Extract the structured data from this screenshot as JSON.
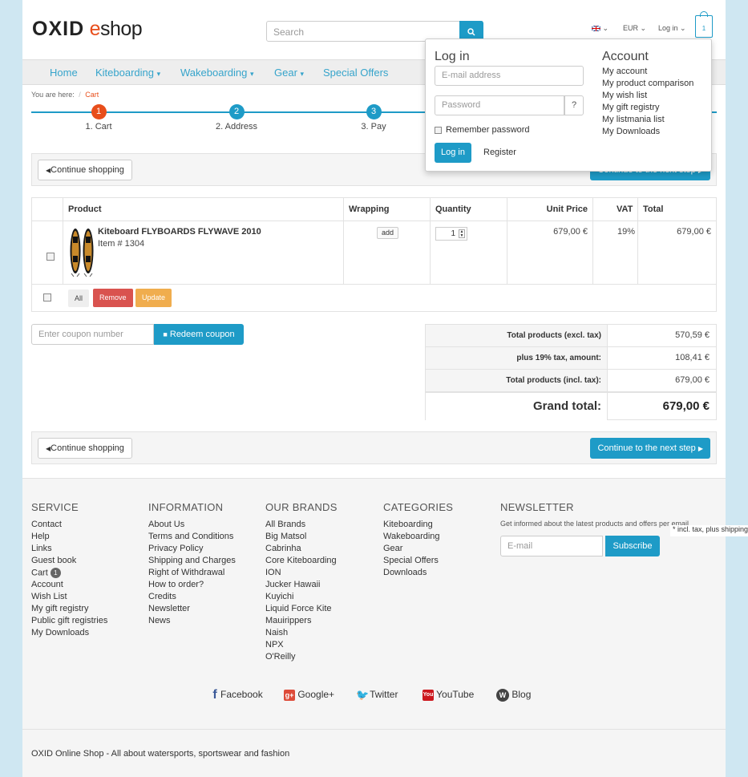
{
  "header": {
    "logo_brand": "OXID",
    "logo_e": "e",
    "logo_rest": "shop",
    "search_placeholder": "Search",
    "language": "",
    "currency": "EUR",
    "login_label": "Log in",
    "cart_count": "1"
  },
  "nav": {
    "items": [
      "Home",
      "Kiteboarding",
      "Wakeboarding",
      "Gear",
      "Special Offers"
    ]
  },
  "breadcrumb": {
    "prefix": "You are here:",
    "sep": "/",
    "current": "Cart"
  },
  "steps": [
    {
      "num": "1",
      "label": "1. Cart"
    },
    {
      "num": "2",
      "label": "2. Address"
    },
    {
      "num": "3",
      "label": "3. Pay"
    }
  ],
  "buttons": {
    "continue_shopping": "Continue shopping",
    "next_step": "Continue to the next step"
  },
  "basket": {
    "headers": {
      "product": "Product",
      "wrapping": "Wrapping",
      "quantity": "Quantity",
      "unit_price": "Unit Price",
      "vat": "VAT",
      "total": "Total"
    },
    "item": {
      "name": "Kiteboard FLYBOARDS FLYWAVE 2010",
      "item_no": "Item # 1304",
      "wrapping_btn": "add",
      "quantity": "1",
      "unit_price": "679,00 €",
      "vat": "19%",
      "total": "679,00 €"
    },
    "actions": {
      "all": "All",
      "remove": "Remove",
      "update": "Update"
    }
  },
  "coupon": {
    "placeholder": "Enter coupon number",
    "button": "Redeem coupon"
  },
  "totals": {
    "excl_label": "Total products (excl. tax)",
    "excl_value": "570,59 €",
    "tax_label": "plus 19% tax, amount:",
    "tax_value": "108,41 €",
    "incl_label": "Total products (incl. tax):",
    "incl_value": "679,00 €",
    "grand_label": "Grand total:",
    "grand_value": "679,00 €"
  },
  "login_popup": {
    "title": "Log in",
    "email_placeholder": "E-mail address",
    "password_placeholder": "Password",
    "help": "?",
    "remember": "Remember password",
    "login_button": "Log in",
    "register": "Register",
    "account_title": "Account",
    "account_links": [
      "My account",
      "My product comparison",
      "My wish list",
      "My gift registry",
      "My listmania list",
      "My Downloads"
    ]
  },
  "footer": {
    "service_title": "SERVICE",
    "service_links": [
      "Contact",
      "Help",
      "Links",
      "Guest book",
      "Cart",
      "Account",
      "Wish List",
      "My gift registry",
      "Public gift registries",
      "My Downloads"
    ],
    "cart_badge": "1",
    "information_title": "INFORMATION",
    "information_links": [
      "About Us",
      "Terms and Conditions",
      "Privacy Policy",
      "Shipping and Charges",
      "Right of Withdrawal",
      "How to order?",
      "Credits",
      "Newsletter",
      "News"
    ],
    "brands_title": "OUR BRANDS",
    "brands_links": [
      "All Brands",
      "Big Matsol",
      "Cabrinha",
      "Core Kiteboarding",
      "ION",
      "Jucker Hawaii",
      "Kuyichi",
      "Liquid Force Kite",
      "Mauirippers",
      "Naish",
      "NPX",
      "O'Reilly"
    ],
    "categories_title": "CATEGORIES",
    "categories_links": [
      "Kiteboarding",
      "Wakeboarding",
      "Gear",
      "Special Offers",
      "Downloads"
    ],
    "newsletter_title": "NEWSLETTER",
    "newsletter_text": "Get informed about the latest products and offers per email.",
    "newsletter_placeholder": "E-mail",
    "newsletter_button": "Subscribe",
    "social": [
      "Facebook",
      "Google+",
      "Twitter",
      "YouTube",
      "Blog"
    ],
    "tagline": "OXID Online Shop - All about watersports, sportswear and fashion"
  },
  "tooltip": "* incl. tax, plus shipping"
}
